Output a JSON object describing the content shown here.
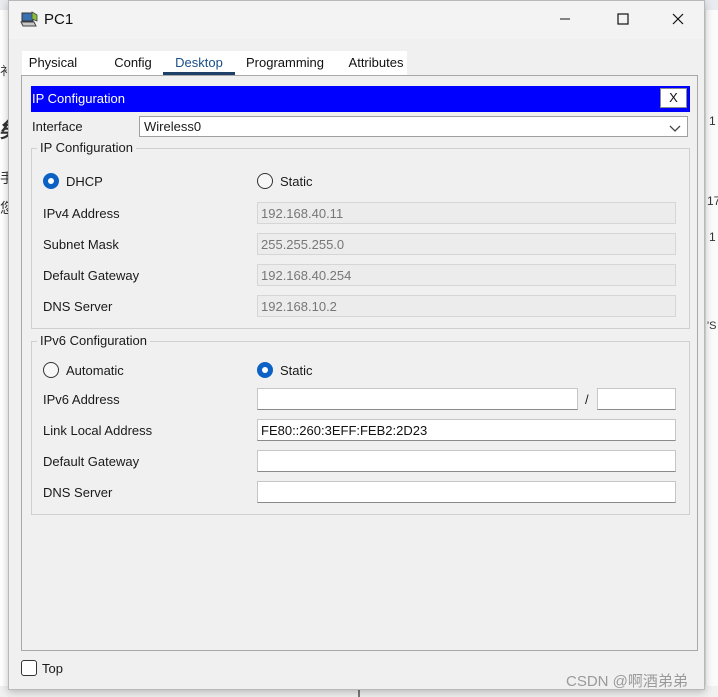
{
  "background": {
    "frag_1": "衤",
    "frag_2": "矣",
    "frag_3": "手",
    "frag_4": "您",
    "frag_5": "1",
    "frag_6": "17",
    "frag_7": "1",
    "frag_8": "'S"
  },
  "window": {
    "title": "PC1",
    "icon": "pc-app-icon",
    "controls": {
      "minimize": "minimize-icon",
      "maximize": "maximize-icon",
      "close": "close-icon"
    }
  },
  "tabs": [
    {
      "label": "Physical"
    },
    {
      "label": "Config"
    },
    {
      "label": "Desktop",
      "active": true
    },
    {
      "label": "Programming"
    },
    {
      "label": "Attributes"
    }
  ],
  "panel": {
    "title": "IP Configuration",
    "close_label": "X",
    "interface_label": "Interface",
    "interface_value": "Wireless0"
  },
  "ipv4": {
    "group_title": "IP Configuration",
    "dhcp_label": "DHCP",
    "static_label": "Static",
    "mode": "DHCP",
    "address_label": "IPv4 Address",
    "address_value": "192.168.40.11",
    "mask_label": "Subnet Mask",
    "mask_value": "255.255.255.0",
    "gateway_label": "Default Gateway",
    "gateway_value": "192.168.40.254",
    "dns_label": "DNS Server",
    "dns_value": "192.168.10.2"
  },
  "ipv6": {
    "group_title": "IPv6 Configuration",
    "auto_label": "Automatic",
    "static_label": "Static",
    "mode": "Static",
    "address_label": "IPv6 Address",
    "address_value": "",
    "prefix_separator": "/",
    "prefix_value": "",
    "link_local_label": "Link Local Address",
    "link_local_value": "FE80::260:3EFF:FEB2:2D23",
    "gateway_label": "Default Gateway",
    "gateway_value": "",
    "dns_label": "DNS Server",
    "dns_value": ""
  },
  "footer": {
    "top_label": "Top",
    "top_checked": false
  },
  "watermark": "CSDN @啊酒弟弟",
  "colors": {
    "header_blue": "#0000ff",
    "radio_selected": "#0b62c4",
    "active_tab_underline": "#1e3f66"
  }
}
